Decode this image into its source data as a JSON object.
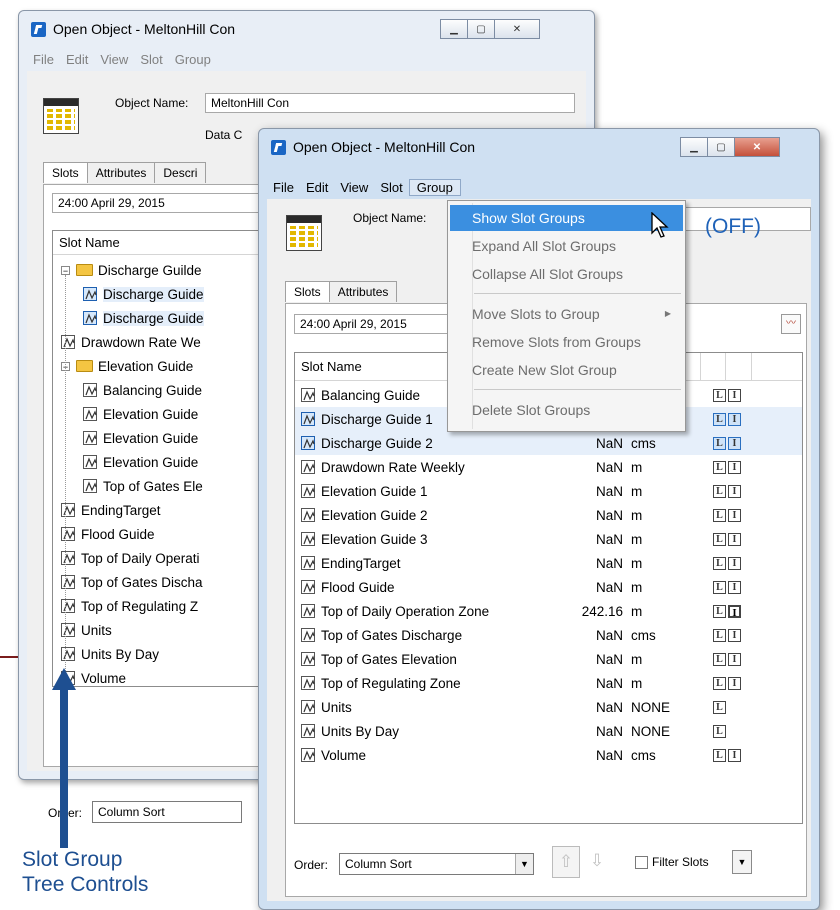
{
  "back_window": {
    "title": "Open Object - MeltonHill Con",
    "menu": [
      "File",
      "Edit",
      "View",
      "Slot",
      "Group"
    ],
    "object_name_label": "Object Name:",
    "object_name_value": "MeltonHill Con",
    "data_label_partial": "Data C",
    "tabs": [
      "Slots",
      "Attributes",
      "Descri"
    ],
    "date": "24:00 April 29, 2015",
    "slot_name_header": "Slot Name",
    "tree": [
      {
        "label": "Discharge Guilde",
        "kind": "folder",
        "level": 0,
        "expander": "−"
      },
      {
        "label": "Discharge Guide",
        "kind": "slot",
        "level": 1,
        "selected": true
      },
      {
        "label": "Discharge Guide",
        "kind": "slot",
        "level": 1,
        "selected": true
      },
      {
        "label": "Drawdown Rate We",
        "kind": "slot",
        "level": 0
      },
      {
        "label": "Elevation Guide",
        "kind": "folder",
        "level": 0,
        "expander": "−"
      },
      {
        "label": "Balancing Guide",
        "kind": "slot",
        "level": 1
      },
      {
        "label": "Elevation Guide",
        "kind": "slot",
        "level": 1
      },
      {
        "label": "Elevation Guide",
        "kind": "slot",
        "level": 1
      },
      {
        "label": "Elevation Guide",
        "kind": "slot",
        "level": 1
      },
      {
        "label": "Top of Gates Ele",
        "kind": "slot",
        "level": 1
      },
      {
        "label": "EndingTarget",
        "kind": "slot",
        "level": 0
      },
      {
        "label": "Flood Guide",
        "kind": "slot",
        "level": 0
      },
      {
        "label": "Top of Daily Operati",
        "kind": "slot",
        "level": 0
      },
      {
        "label": "Top of Gates Discha",
        "kind": "slot",
        "level": 0
      },
      {
        "label": "Top of Regulating Z",
        "kind": "slot",
        "level": 0
      },
      {
        "label": "Units",
        "kind": "slot",
        "level": 0
      },
      {
        "label": "Units By Day",
        "kind": "slot",
        "level": 0
      },
      {
        "label": "Volume",
        "kind": "slot",
        "level": 0
      }
    ],
    "order_label": "Order:",
    "order_value": "Column Sort"
  },
  "front_window": {
    "title": "Open Object - MeltonHill Con",
    "menu": [
      "File",
      "Edit",
      "View",
      "Slot",
      "Group"
    ],
    "object_name_label": "Object Name:",
    "off_label": "(OFF)",
    "tabs": [
      "Slots",
      "Attributes"
    ],
    "date": "24:00 April 29, 2015",
    "slot_name_header": "Slot Name",
    "rows": [
      {
        "name": "Balancing Guide",
        "value": "",
        "unit": "",
        "flags": [
          "L",
          "I"
        ],
        "selected": false
      },
      {
        "name": "Discharge Guide 1",
        "value": "",
        "unit": "",
        "flags": [
          "L",
          "I"
        ],
        "selected": true
      },
      {
        "name": "Discharge Guide 2",
        "value": "NaN",
        "unit": "cms",
        "flags": [
          "L",
          "I"
        ],
        "selected": true
      },
      {
        "name": "Drawdown Rate Weekly",
        "value": "NaN",
        "unit": "m",
        "flags": [
          "L",
          "I"
        ],
        "selected": false
      },
      {
        "name": "Elevation Guide 1",
        "value": "NaN",
        "unit": "m",
        "flags": [
          "L",
          "I"
        ],
        "selected": false
      },
      {
        "name": "Elevation Guide 2",
        "value": "NaN",
        "unit": "m",
        "flags": [
          "L",
          "I"
        ],
        "selected": false
      },
      {
        "name": "Elevation Guide 3",
        "value": "NaN",
        "unit": "m",
        "flags": [
          "L",
          "I"
        ],
        "selected": false
      },
      {
        "name": "EndingTarget",
        "value": "NaN",
        "unit": "m",
        "flags": [
          "L",
          "I"
        ],
        "selected": false
      },
      {
        "name": "Flood Guide",
        "value": "NaN",
        "unit": "m",
        "flags": [
          "L",
          "I"
        ],
        "selected": false
      },
      {
        "name": "Top of Daily Operation Zone",
        "value": "242.16",
        "unit": "m",
        "flags": [
          "L",
          "I"
        ],
        "selected": false,
        "strong_i": true
      },
      {
        "name": "Top of Gates Discharge",
        "value": "NaN",
        "unit": "cms",
        "flags": [
          "L",
          "I"
        ],
        "selected": false
      },
      {
        "name": "Top of Gates Elevation",
        "value": "NaN",
        "unit": "m",
        "flags": [
          "L",
          "I"
        ],
        "selected": false
      },
      {
        "name": "Top of Regulating Zone",
        "value": "NaN",
        "unit": "m",
        "flags": [
          "L",
          "I"
        ],
        "selected": false
      },
      {
        "name": "Units",
        "value": "NaN",
        "unit": "NONE",
        "flags": [
          "L"
        ],
        "selected": false
      },
      {
        "name": "Units By Day",
        "value": "NaN",
        "unit": "NONE",
        "flags": [
          "L"
        ],
        "selected": false
      },
      {
        "name": "Volume",
        "value": "NaN",
        "unit": "cms",
        "flags": [
          "L",
          "I"
        ],
        "selected": false
      }
    ],
    "order_label": "Order:",
    "order_value": "Column Sort",
    "filter_label": "Filter Slots"
  },
  "group_menu": {
    "items": [
      {
        "label": "Show Slot Groups",
        "highlighted": true
      },
      {
        "label": "Expand All Slot Groups"
      },
      {
        "label": "Collapse All Slot Groups"
      },
      {
        "separator": true
      },
      {
        "label": "Move Slots to Group",
        "submenu": true
      },
      {
        "label": "Remove Slots from Groups"
      },
      {
        "label": "Create New Slot Group"
      },
      {
        "separator": true
      },
      {
        "label": "Delete Slot Groups"
      }
    ]
  },
  "annotation": {
    "caption_line1": "Slot Group",
    "caption_line2": "Tree Controls",
    "color": "#1e4f91"
  }
}
